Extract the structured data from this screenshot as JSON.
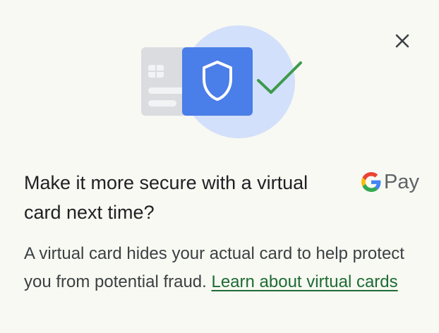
{
  "dialog": {
    "title": "Make it more secure with a virtual card next time?",
    "brand_text": "Pay",
    "body": "A virtual card hides your actual card to help protect you from potential fraud. ",
    "learn_link": "Learn about virtual cards"
  },
  "colors": {
    "background": "#f8f9f2",
    "card_gray": "#dadce0",
    "card_blue": "#4a7ee8",
    "halo_blue": "#d3e0fb",
    "check_green": "#3c9a4b",
    "link_green": "#1e6b34"
  },
  "icons": [
    "shield-icon",
    "check-icon",
    "close-icon",
    "google-g-icon"
  ]
}
